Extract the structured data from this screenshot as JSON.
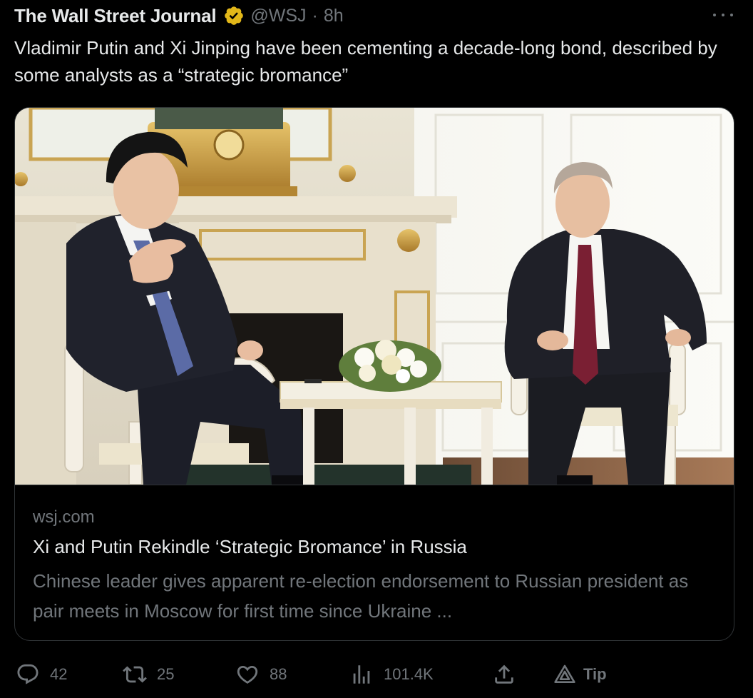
{
  "tweet": {
    "author_name": "The Wall Street Journal",
    "handle": "@WSJ",
    "separator": "·",
    "time": "8h",
    "text": "Vladimir Putin and Xi Jinping have been cementing a decade-long bond, described by some analysts as a “strategic bromance”"
  },
  "card": {
    "domain": "wsj.com",
    "title": "Xi and Putin Rekindle ‘Strategic Bromance’ in Russia",
    "description": "Chinese leader gives apparent re-election endorsement to Russian president as pair meets in Moscow for first time since Ukraine ..."
  },
  "actions": {
    "replies": "42",
    "retweets": "25",
    "likes": "88",
    "views": "101.4K",
    "tip_label": "Tip"
  },
  "icons": {
    "verified": "verified-badge-icon",
    "more": "more-icon",
    "reply": "reply-icon",
    "retweet": "retweet-icon",
    "like": "heart-icon",
    "views": "views-icon",
    "share": "share-icon",
    "tip": "tip-icon"
  },
  "colors": {
    "background": "#000000",
    "text": "#e7e9ea",
    "muted": "#71767b",
    "border": "#2f3336",
    "verified_gold": "#e2b719"
  }
}
